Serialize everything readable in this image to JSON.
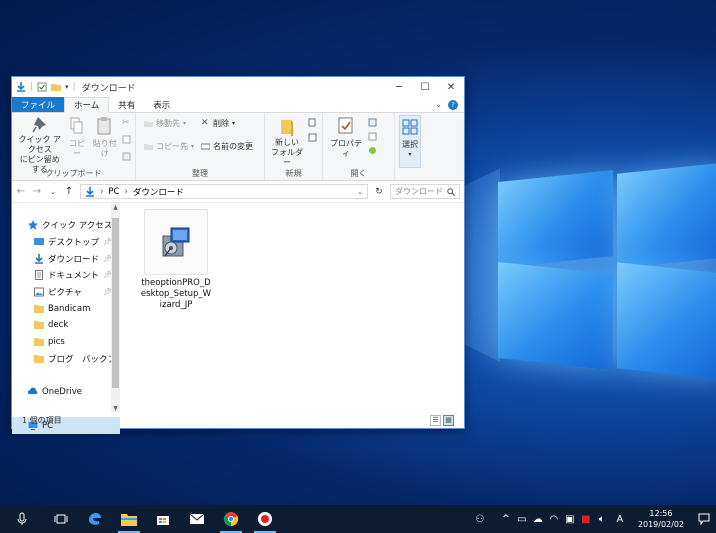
{
  "window": {
    "title": "ダウンロード",
    "tabs": [
      {
        "label": "ファイル"
      },
      {
        "label": "ホーム"
      },
      {
        "label": "共有"
      },
      {
        "label": "表示"
      }
    ],
    "help_glyph": "?"
  },
  "ribbon": {
    "clipboard": {
      "pin_label": "クイック アクセス\nにピン留めする",
      "copy": "コピー",
      "paste": "貼り付け",
      "group": "クリップボード"
    },
    "organize": {
      "move_to": "移動先",
      "copy_to": "コピー先",
      "delete": "削除",
      "rename": "名前の変更",
      "group": "整理"
    },
    "new": {
      "new_folder": "新しい\nフォルダー",
      "group": "新規"
    },
    "open": {
      "properties": "プロパティ",
      "group": "開く"
    },
    "select": {
      "select": "選択"
    }
  },
  "address": {
    "path": [
      "PC",
      "ダウンロード"
    ],
    "search_placeholder": "ダウンロード"
  },
  "nav": {
    "items": [
      {
        "label": "クイック アクセス",
        "icon": "star-icon",
        "pinned": false,
        "selected": false
      },
      {
        "label": "デスクトップ",
        "icon": "desktop-icon",
        "pinned": true,
        "selected": false
      },
      {
        "label": "ダウンロード",
        "icon": "download-icon",
        "pinned": true,
        "selected": false
      },
      {
        "label": "ドキュメント",
        "icon": "document-icon",
        "pinned": true,
        "selected": false
      },
      {
        "label": "ピクチャ",
        "icon": "pictures-icon",
        "pinned": true,
        "selected": false
      },
      {
        "label": "Bandicam",
        "icon": "folder-icon",
        "pinned": false,
        "selected": false
      },
      {
        "label": "deck",
        "icon": "folder-icon",
        "pinned": false,
        "selected": false
      },
      {
        "label": "pics",
        "icon": "folder-icon",
        "pinned": false,
        "selected": false
      },
      {
        "label": "ブログ　バックアップ",
        "icon": "folder-icon",
        "pinned": false,
        "selected": false
      },
      {
        "label": "",
        "icon": "",
        "pinned": false,
        "selected": false
      },
      {
        "label": "OneDrive",
        "icon": "onedrive-icon",
        "pinned": false,
        "selected": false
      },
      {
        "label": "",
        "icon": "",
        "pinned": false,
        "selected": false
      },
      {
        "label": "PC",
        "icon": "pc-icon",
        "pinned": false,
        "selected": true
      }
    ]
  },
  "files": [
    {
      "name": "theoptionPRO_Desktop_Setup_Wizard_JP",
      "icon": "installer-icon"
    }
  ],
  "status": {
    "item_count": "1 個の項目"
  },
  "taskbar": {
    "ime": "A",
    "time": "12:56",
    "date": "2019/02/02"
  },
  "colors": {
    "accent": "#1979ca",
    "taskbar": "#0c1c33"
  }
}
